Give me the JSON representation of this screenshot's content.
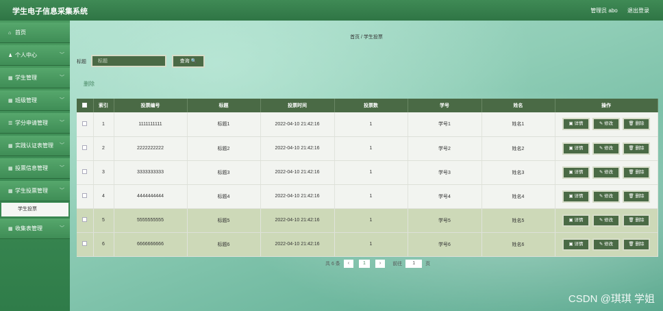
{
  "header": {
    "title": "学生电子信息采集系统",
    "admin": "管理员 abo",
    "logout": "退出登录"
  },
  "sidebar": {
    "items": [
      {
        "icon": "⌂",
        "label": "首页",
        "chevron": ""
      },
      {
        "icon": "♟",
        "label": "个人中心",
        "chevron": "﹀"
      },
      {
        "icon": "▦",
        "label": "学生管理",
        "chevron": "﹀"
      },
      {
        "icon": "▦",
        "label": "班级管理",
        "chevron": "﹀"
      },
      {
        "icon": "☰",
        "label": "学分申请管理",
        "chevron": "﹀"
      },
      {
        "icon": "▦",
        "label": "实践认证表管理",
        "chevron": "﹀"
      },
      {
        "icon": "▦",
        "label": "投票信息管理",
        "chevron": "﹀"
      },
      {
        "icon": "▦",
        "label": "学生投票管理",
        "chevron": "﹀"
      }
    ],
    "sub_item": "学生投票",
    "after_item": {
      "icon": "▦",
      "label": "收集表管理",
      "chevron": "﹀"
    }
  },
  "breadcrumb": "首页 / 学生投票",
  "search": {
    "label": "标题",
    "placeholder": "标题",
    "button": "查询 🔍"
  },
  "delete_label": "删除",
  "table": {
    "headers": [
      "索引",
      "投票编号",
      "标题",
      "投票时间",
      "投票数",
      "学号",
      "姓名",
      "操作"
    ],
    "rows": [
      {
        "index": "1",
        "code": "1111111111",
        "title": "标题1",
        "time": "2022-04-10 21:42:16",
        "count": "1",
        "student_no": "学号1",
        "name": "姓名1"
      },
      {
        "index": "2",
        "code": "2222222222",
        "title": "标题2",
        "time": "2022-04-10 21:42:16",
        "count": "1",
        "student_no": "学号2",
        "name": "姓名2"
      },
      {
        "index": "3",
        "code": "3333333333",
        "title": "标题3",
        "time": "2022-04-10 21:42:16",
        "count": "1",
        "student_no": "学号3",
        "name": "姓名3"
      },
      {
        "index": "4",
        "code": "4444444444",
        "title": "标题4",
        "time": "2022-04-10 21:42:16",
        "count": "1",
        "student_no": "学号4",
        "name": "姓名4"
      },
      {
        "index": "5",
        "code": "5555555555",
        "title": "标题5",
        "time": "2022-04-10 21:42:16",
        "count": "1",
        "student_no": "学号5",
        "name": "姓名5"
      },
      {
        "index": "6",
        "code": "6666666666",
        "title": "标题6",
        "time": "2022-04-10 21:42:16",
        "count": "1",
        "student_no": "学号6",
        "name": "姓名6"
      }
    ],
    "actions": {
      "detail": "▣ 详情",
      "edit": "✎ 修改",
      "delete": "🗑 删除"
    }
  },
  "pager": {
    "total": "共 6 条",
    "prev": "‹",
    "page": "1",
    "next": "›",
    "goto": "前往",
    "goto_value": "1",
    "suffix": "页"
  },
  "watermark": "CSDN @琪琪 学姐"
}
